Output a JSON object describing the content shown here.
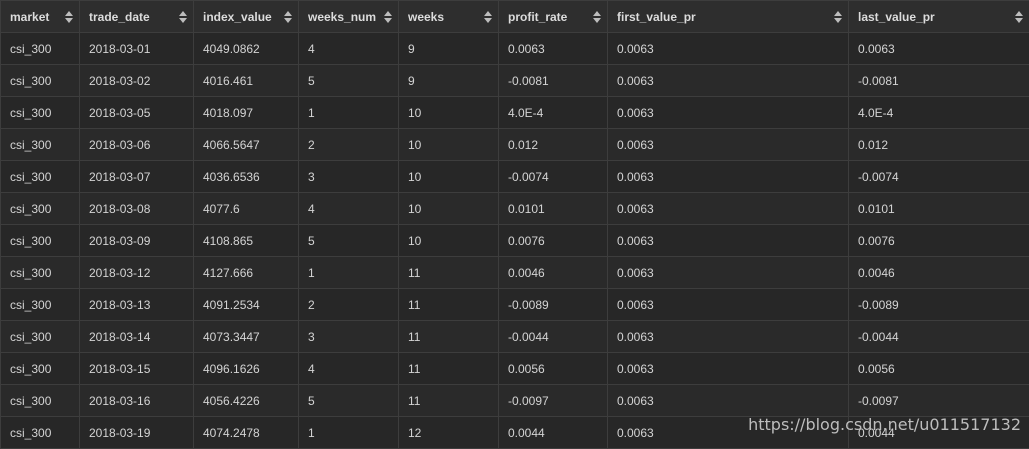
{
  "columns": [
    "market",
    "trade_date",
    "index_value",
    "weeks_num",
    "weeks",
    "profit_rate",
    "first_value_pr",
    "last_value_pr"
  ],
  "rows": [
    [
      "csi_300",
      "2018-03-01",
      "4049.0862",
      "4",
      "9",
      "0.0063",
      "0.0063",
      "0.0063"
    ],
    [
      "csi_300",
      "2018-03-02",
      "4016.461",
      "5",
      "9",
      "-0.0081",
      "0.0063",
      "-0.0081"
    ],
    [
      "csi_300",
      "2018-03-05",
      "4018.097",
      "1",
      "10",
      "4.0E-4",
      "0.0063",
      "4.0E-4"
    ],
    [
      "csi_300",
      "2018-03-06",
      "4066.5647",
      "2",
      "10",
      "0.012",
      "0.0063",
      "0.012"
    ],
    [
      "csi_300",
      "2018-03-07",
      "4036.6536",
      "3",
      "10",
      "-0.0074",
      "0.0063",
      "-0.0074"
    ],
    [
      "csi_300",
      "2018-03-08",
      "4077.6",
      "4",
      "10",
      "0.0101",
      "0.0063",
      "0.0101"
    ],
    [
      "csi_300",
      "2018-03-09",
      "4108.865",
      "5",
      "10",
      "0.0076",
      "0.0063",
      "0.0076"
    ],
    [
      "csi_300",
      "2018-03-12",
      "4127.666",
      "1",
      "11",
      "0.0046",
      "0.0063",
      "0.0046"
    ],
    [
      "csi_300",
      "2018-03-13",
      "4091.2534",
      "2",
      "11",
      "-0.0089",
      "0.0063",
      "-0.0089"
    ],
    [
      "csi_300",
      "2018-03-14",
      "4073.3447",
      "3",
      "11",
      "-0.0044",
      "0.0063",
      "-0.0044"
    ],
    [
      "csi_300",
      "2018-03-15",
      "4096.1626",
      "4",
      "11",
      "0.0056",
      "0.0063",
      "0.0056"
    ],
    [
      "csi_300",
      "2018-03-16",
      "4056.4226",
      "5",
      "11",
      "-0.0097",
      "0.0063",
      "-0.0097"
    ],
    [
      "csi_300",
      "2018-03-19",
      "4074.2478",
      "1",
      "12",
      "0.0044",
      "0.0063",
      "0.0044"
    ]
  ],
  "watermark": "https://blog.csdn.net/u011517132",
  "colors": {
    "background": "#232323",
    "header_bg": "#2e2e2e",
    "grid_line": "#3d3d3d",
    "text": "#d4d4d4"
  }
}
